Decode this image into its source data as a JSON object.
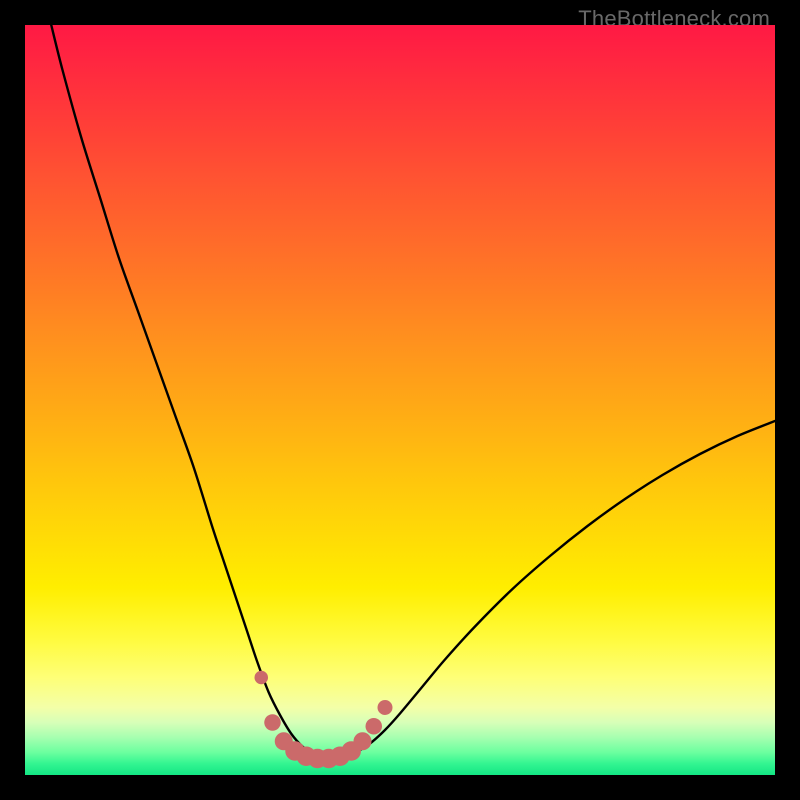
{
  "watermark": "TheBottleneck.com",
  "chart_data": {
    "type": "line",
    "title": "",
    "xlabel": "",
    "ylabel": "",
    "xlim": [
      0,
      100
    ],
    "ylim": [
      0,
      100
    ],
    "grid": false,
    "legend": false,
    "curve_color": "#000000",
    "marker_color": "#cb6a6a",
    "gradient_stops": [
      {
        "offset": 0.0,
        "color": "#ff1944"
      },
      {
        "offset": 0.05,
        "color": "#ff2740"
      },
      {
        "offset": 0.1,
        "color": "#ff353b"
      },
      {
        "offset": 0.15,
        "color": "#ff4336"
      },
      {
        "offset": 0.2,
        "color": "#ff5232"
      },
      {
        "offset": 0.25,
        "color": "#ff602d"
      },
      {
        "offset": 0.3,
        "color": "#ff6e29"
      },
      {
        "offset": 0.35,
        "color": "#ff7c24"
      },
      {
        "offset": 0.4,
        "color": "#ff8b20"
      },
      {
        "offset": 0.45,
        "color": "#ff991b"
      },
      {
        "offset": 0.5,
        "color": "#ffa716"
      },
      {
        "offset": 0.55,
        "color": "#ffb512"
      },
      {
        "offset": 0.6,
        "color": "#ffc40d"
      },
      {
        "offset": 0.65,
        "color": "#ffd209"
      },
      {
        "offset": 0.7,
        "color": "#ffe004"
      },
      {
        "offset": 0.75,
        "color": "#ffee00"
      },
      {
        "offset": 0.78,
        "color": "#fff41a"
      },
      {
        "offset": 0.82,
        "color": "#fffb3f"
      },
      {
        "offset": 0.87,
        "color": "#feff77"
      },
      {
        "offset": 0.91,
        "color": "#f3ffa8"
      },
      {
        "offset": 0.93,
        "color": "#d7ffb8"
      },
      {
        "offset": 0.95,
        "color": "#a6ffb0"
      },
      {
        "offset": 0.97,
        "color": "#6bff9f"
      },
      {
        "offset": 0.985,
        "color": "#33f591"
      },
      {
        "offset": 1.0,
        "color": "#13e684"
      }
    ],
    "series": [
      {
        "name": "curve",
        "x": [
          3.5,
          5,
          7.5,
          10,
          12.5,
          15,
          17.5,
          20,
          22.5,
          25,
          26.5,
          28,
          29.5,
          31,
          32.5,
          34,
          35.5,
          37,
          38.5,
          40,
          42,
          44,
          46,
          48,
          50,
          53,
          56,
          60,
          65,
          70,
          75,
          80,
          85,
          90,
          95,
          100
        ],
        "y": [
          100,
          94,
          85,
          77,
          69,
          62,
          55,
          48,
          41,
          33,
          28.5,
          24,
          19.5,
          15,
          11,
          8,
          5.5,
          3.8,
          2.8,
          2.3,
          2.4,
          3.0,
          4.2,
          6.0,
          8.2,
          11.8,
          15.4,
          19.8,
          24.8,
          29.2,
          33.2,
          36.8,
          40.0,
          42.8,
          45.2,
          47.2
        ]
      }
    ],
    "markers": [
      {
        "x": 31.5,
        "y": 13.0,
        "r": 0.9
      },
      {
        "x": 33.0,
        "y": 7.0,
        "r": 1.1
      },
      {
        "x": 34.5,
        "y": 4.5,
        "r": 1.2
      },
      {
        "x": 36.0,
        "y": 3.2,
        "r": 1.3
      },
      {
        "x": 37.5,
        "y": 2.5,
        "r": 1.3
      },
      {
        "x": 39.0,
        "y": 2.2,
        "r": 1.3
      },
      {
        "x": 40.5,
        "y": 2.2,
        "r": 1.3
      },
      {
        "x": 42.0,
        "y": 2.5,
        "r": 1.3
      },
      {
        "x": 43.5,
        "y": 3.2,
        "r": 1.3
      },
      {
        "x": 45.0,
        "y": 4.5,
        "r": 1.2
      },
      {
        "x": 46.5,
        "y": 6.5,
        "r": 1.1
      },
      {
        "x": 48.0,
        "y": 9.0,
        "r": 1.0
      }
    ]
  }
}
